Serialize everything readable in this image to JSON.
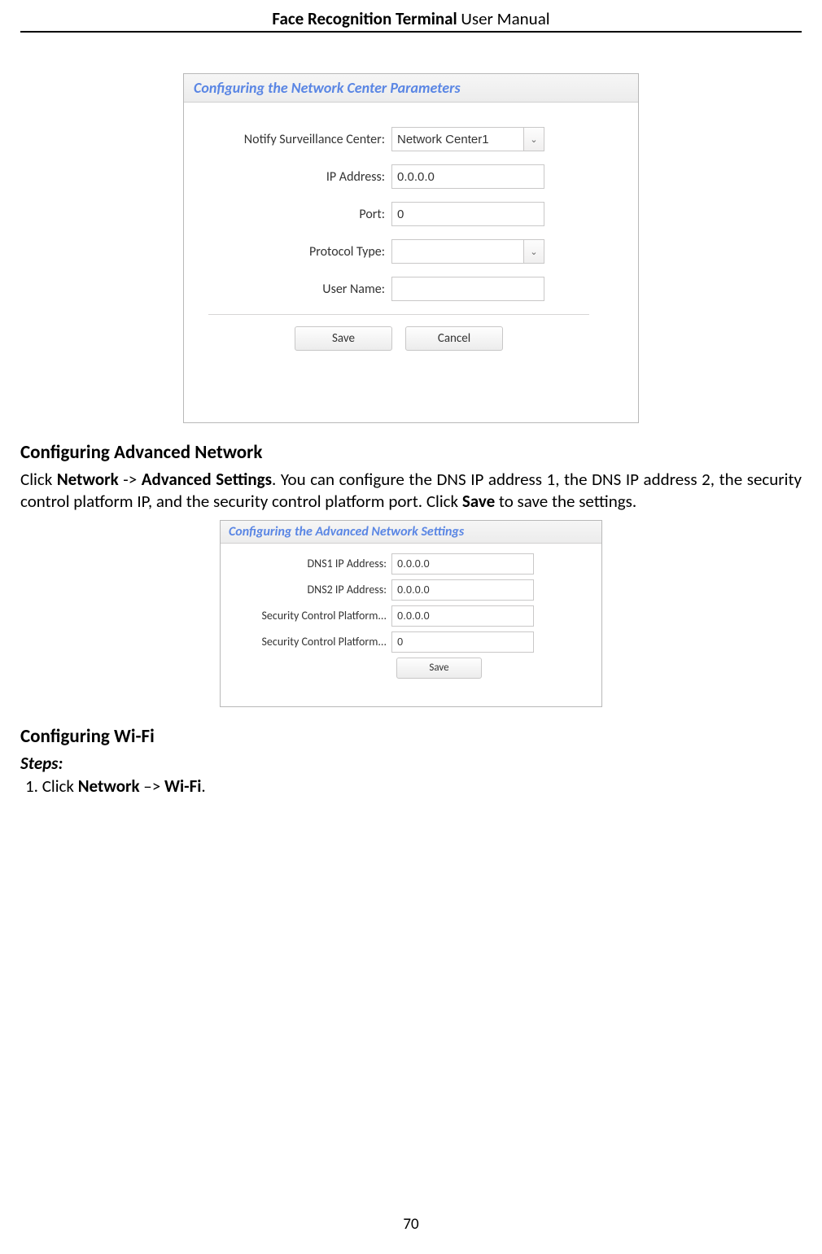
{
  "header": {
    "bold": "Face Recognition Terminal",
    "rest": "  User Manual"
  },
  "footer": {
    "page_number": "70"
  },
  "panel1": {
    "title": "Configuring the Network Center Parameters",
    "fields": {
      "notify_label": "Notify Surveillance Center:",
      "notify_value": "Network Center1",
      "ip_label": "IP Address:",
      "ip_value": "0.0.0.0",
      "port_label": "Port:",
      "port_value": "0",
      "protocol_label": "Protocol Type:",
      "protocol_value": "",
      "user_label": "User Name:",
      "user_value": ""
    },
    "buttons": {
      "save": "Save",
      "cancel": "Cancel"
    }
  },
  "section_advanced": {
    "heading": "Configuring Advanced Network",
    "para_parts": {
      "p1": "Click ",
      "b1": "Network",
      "p2": " -> ",
      "b2": "Advanced Settings",
      "p3": ". You can configure the DNS IP address 1, the DNS IP address 2, the security control platform IP, and the security control platform port. Click ",
      "b3": "Save",
      "p4": " to save the settings."
    }
  },
  "panel2": {
    "title": "Configuring the Advanced Network Settings",
    "fields": {
      "dns1_label": "DNS1 IP Address:",
      "dns1_value": "0.0.0.0",
      "dns2_label": "DNS2 IP Address:",
      "dns2_value": "0.0.0.0",
      "scp1_label": "Security Control Platform...",
      "scp1_value": "0.0.0.0",
      "scp2_label": "Security Control Platform...",
      "scp2_value": "0"
    },
    "buttons": {
      "save": "Save"
    }
  },
  "section_wifi": {
    "heading": "Configuring Wi-Fi",
    "steps_label": "Steps:",
    "step1": {
      "num": "1.   Click ",
      "b1": "Network",
      "mid": " –> ",
      "b2": "Wi-Fi",
      "end": "."
    }
  }
}
